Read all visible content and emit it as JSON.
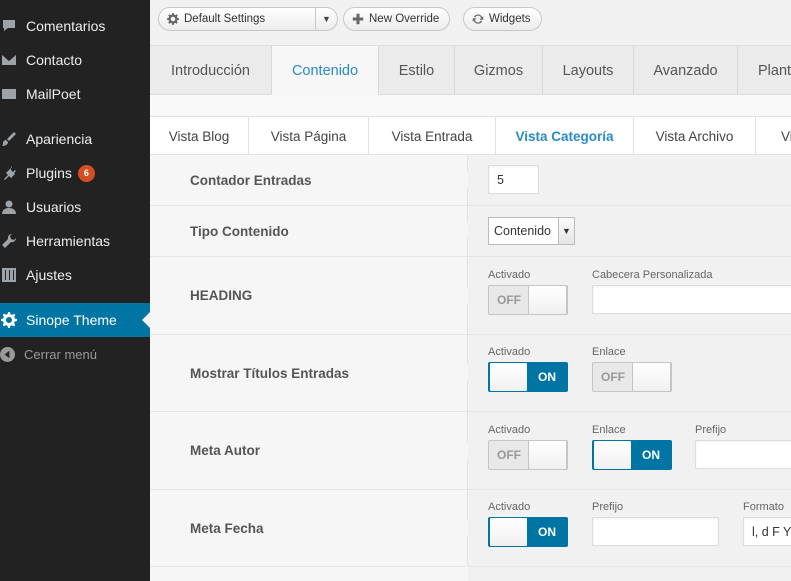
{
  "sidebar": {
    "items": [
      {
        "label": "Comentarios",
        "icon": "comment-icon"
      },
      {
        "label": "Contacto",
        "icon": "mail-icon"
      },
      {
        "label": "MailPoet",
        "icon": "mail-icon"
      },
      {
        "label": "Apariencia",
        "icon": "brush-icon"
      },
      {
        "label": "Plugins",
        "icon": "plug-icon",
        "badge": "6"
      },
      {
        "label": "Usuarios",
        "icon": "user-icon"
      },
      {
        "label": "Herramientas",
        "icon": "wrench-icon"
      },
      {
        "label": "Ajustes",
        "icon": "sliders-icon"
      },
      {
        "label": "Sinope Theme",
        "icon": "gear-icon"
      }
    ],
    "collapse_label": "Cerrar menú"
  },
  "toolbar": {
    "settings_select": "Default Settings",
    "new_override": "New Override",
    "widgets": "Widgets"
  },
  "main_tabs": [
    "Introducción",
    "Contenido",
    "Estilo",
    "Gizmos",
    "Layouts",
    "Avanzado",
    "Plantillas"
  ],
  "main_tabs_active": "Contenido",
  "sub_tabs": [
    "Vista Blog",
    "Vista Página",
    "Vista Entrada",
    "Vista Categoría",
    "Vista Archivo",
    "Vista"
  ],
  "sub_tabs_active": "Vista Categoría",
  "rows": {
    "contador": {
      "label": "Contador Entradas",
      "value": "5"
    },
    "tipo": {
      "label": "Tipo Contenido",
      "value": "Contenido"
    },
    "heading": {
      "label": "HEADING",
      "activado_label": "Activado",
      "activado": "OFF",
      "cabecera_label": "Cabecera Personalizada",
      "cabecera_value": ""
    },
    "titulos": {
      "label": "Mostrar Títulos Entradas",
      "activado_label": "Activado",
      "activado": "ON",
      "enlace_label": "Enlace",
      "enlace": "OFF"
    },
    "autor": {
      "label": "Meta Autor",
      "activado_label": "Activado",
      "activado": "OFF",
      "enlace_label": "Enlace",
      "enlace": "ON",
      "prefijo_label": "Prefijo",
      "prefijo_value": ""
    },
    "fecha": {
      "label": "Meta Fecha",
      "activado_label": "Activado",
      "activado": "ON",
      "prefijo_label": "Prefijo",
      "prefijo_value": "",
      "formato_label": "Formato",
      "formato_value": "l, d F Y"
    }
  },
  "colors": {
    "accent": "#0074a2",
    "tab_active": "#2a8bc5",
    "badge": "#d54e21",
    "sidebar_bg": "#222222"
  }
}
